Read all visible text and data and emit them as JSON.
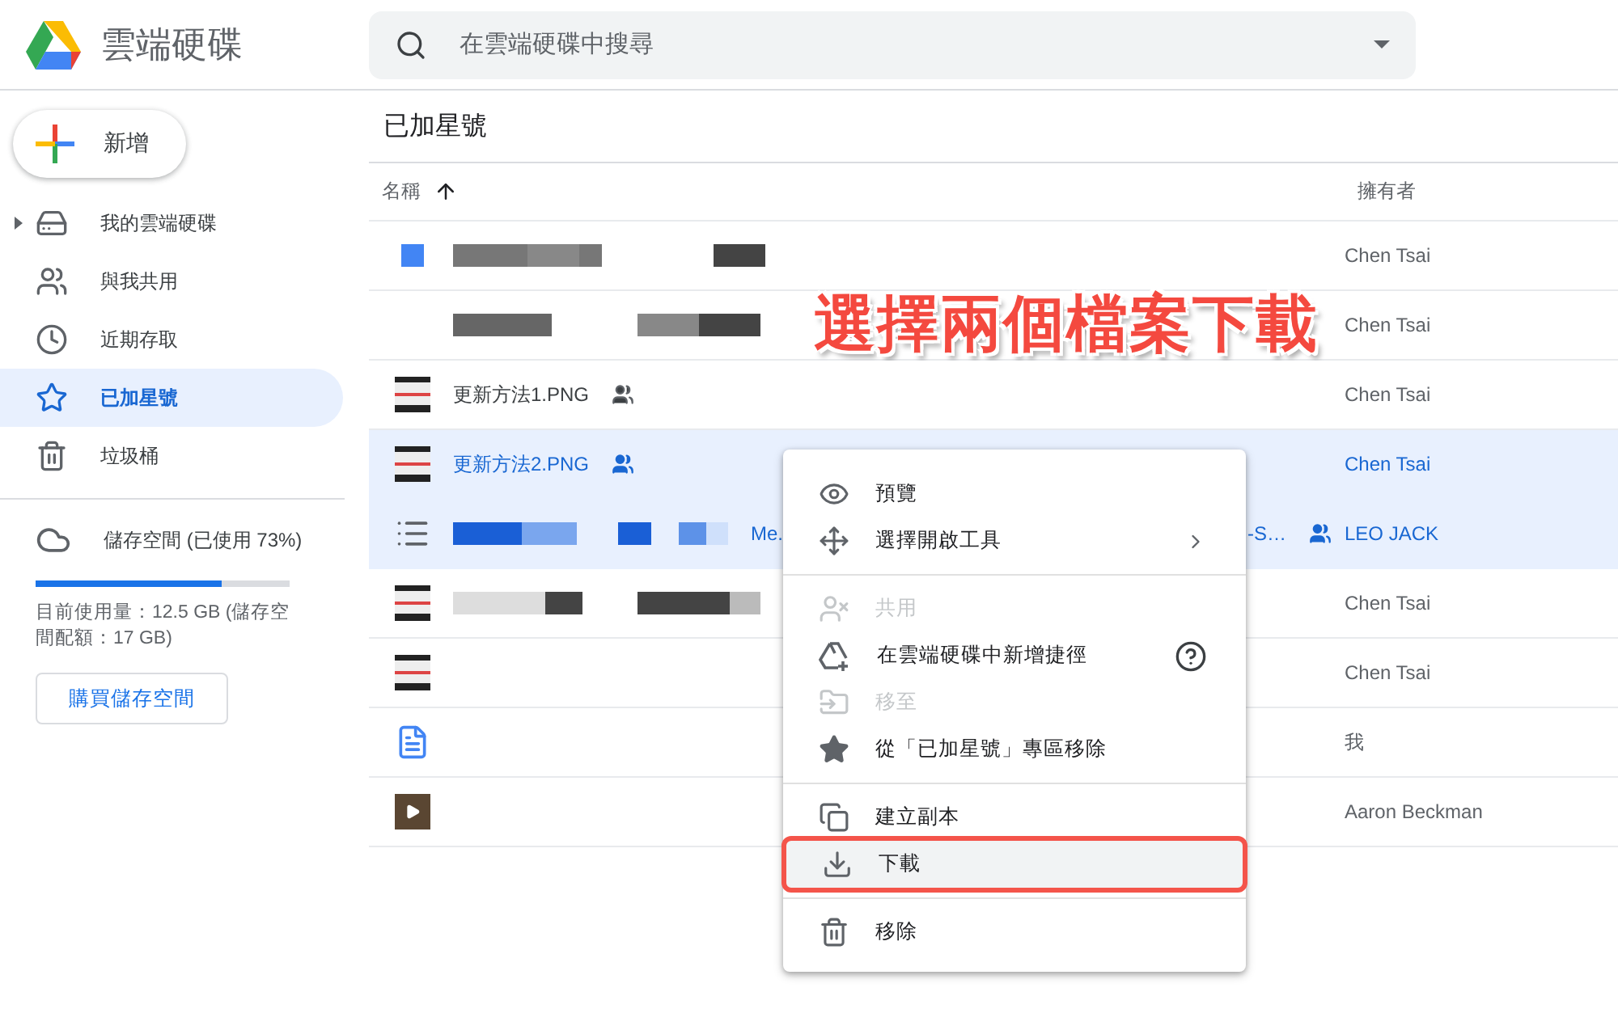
{
  "app": {
    "title": "雲端硬碟"
  },
  "search": {
    "placeholder": "在雲端硬碟中搜尋"
  },
  "new_button": {
    "label": "新增"
  },
  "sidebar": {
    "items": [
      {
        "kind": "drive",
        "label": "我的雲端硬碟",
        "expandable": true,
        "selected": false
      },
      {
        "kind": "shared",
        "label": "與我共用",
        "expandable": false,
        "selected": false
      },
      {
        "kind": "recent",
        "label": "近期存取",
        "expandable": false,
        "selected": false
      },
      {
        "kind": "starred",
        "label": "已加星號",
        "expandable": false,
        "selected": true
      },
      {
        "kind": "trash",
        "label": "垃圾桶",
        "expandable": false,
        "selected": false
      }
    ]
  },
  "storage": {
    "label": "儲存空間 (已使用 73%)",
    "level": 0.73,
    "usage": "目前使用量：12.5 GB (儲存空間配額：17 GB)",
    "buy_button": "購買儲存空間"
  },
  "page_title": "已加星號",
  "table": {
    "columns": [
      {
        "label": "名稱"
      },
      {
        "label": "擁有者"
      }
    ],
    "rows": [
      {
        "kind": "square",
        "pixelated": true,
        "owner": "Chen Tsai",
        "selected": false
      },
      {
        "kind": "blank",
        "pixelated": true,
        "owner": "Chen Tsai",
        "selected": false
      },
      {
        "kind": "image",
        "name": "更新方法1.PNG",
        "shared": true,
        "owner": "Chen Tsai",
        "selected": false
      },
      {
        "kind": "image",
        "name": "更新方法2.PNG",
        "shared": true,
        "owner": "Chen Tsai",
        "selected": true
      },
      {
        "kind": "list",
        "pixelated": true,
        "name": "Me.",
        "name_tail": "-S…",
        "shared": true,
        "owner": "LEO JACK",
        "selected": true
      },
      {
        "kind": "image",
        "pixelated": true,
        "owner": "Chen Tsai",
        "selected": false
      },
      {
        "kind": "image",
        "owner": "Chen Tsai",
        "selected": false
      },
      {
        "kind": "doc",
        "owner": "我",
        "selected": false
      },
      {
        "kind": "video",
        "owner": "Aaron Beckman",
        "selected": false
      }
    ]
  },
  "context_menu": {
    "items": [
      {
        "kind": "eye",
        "label": "預覽",
        "disabled": false
      },
      {
        "kind": "move",
        "label": "選擇開啟工具",
        "disabled": false,
        "submenu": true
      },
      {
        "kind": "divider"
      },
      {
        "kind": "share",
        "label": "共用",
        "disabled": true
      },
      {
        "kind": "shortcut",
        "label": "在雲端硬碟中新增捷徑",
        "disabled": false,
        "help": true
      },
      {
        "kind": "moveto",
        "label": "移至",
        "disabled": true
      },
      {
        "kind": "star",
        "label": "從「已加星號」專區移除",
        "disabled": false
      },
      {
        "kind": "divider"
      },
      {
        "kind": "copy",
        "label": "建立副本",
        "disabled": false
      },
      {
        "kind": "download",
        "label": "下載",
        "disabled": false,
        "highlighted": true
      },
      {
        "kind": "divider"
      },
      {
        "kind": "trash",
        "label": "移除",
        "disabled": false
      }
    ]
  },
  "annotation": {
    "text": "選擇兩個檔案下載"
  }
}
